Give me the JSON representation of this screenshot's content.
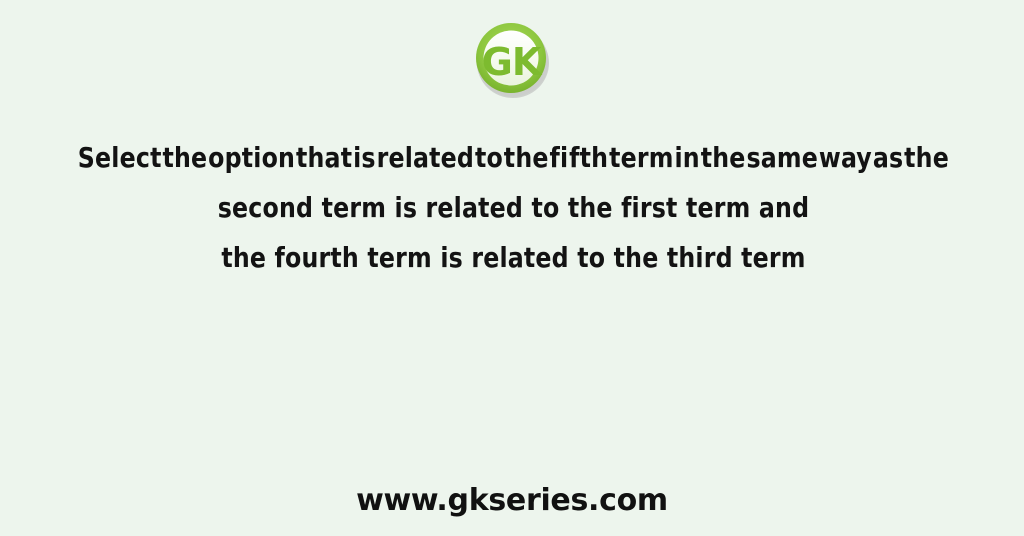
{
  "background_color": "#edf5ed",
  "logo": {
    "name": "gk-logo",
    "text": "GK",
    "ring_color": "#8CC63E",
    "letter_color": "#7DBB2F",
    "inner_color": "#f6fbf0",
    "shadow_color": "#b9b9b9"
  },
  "question": {
    "lines": [
      {
        "align": "justify",
        "text": "Select the option that is related to the fi fth term in the same way as the",
        "words": [
          "Select",
          "the",
          "option",
          "that",
          "is",
          "related",
          "to",
          "the",
          "fi",
          "fth",
          "term",
          "in",
          "the",
          "same",
          "way",
          "as",
          "the"
        ]
      },
      {
        "align": "center",
        "text": "second term is related to the first term and"
      },
      {
        "align": "center",
        "text": "the fourth term is related to the third term"
      }
    ],
    "text_color": "#131313"
  },
  "footer": {
    "website": "www.gkseries.com"
  }
}
